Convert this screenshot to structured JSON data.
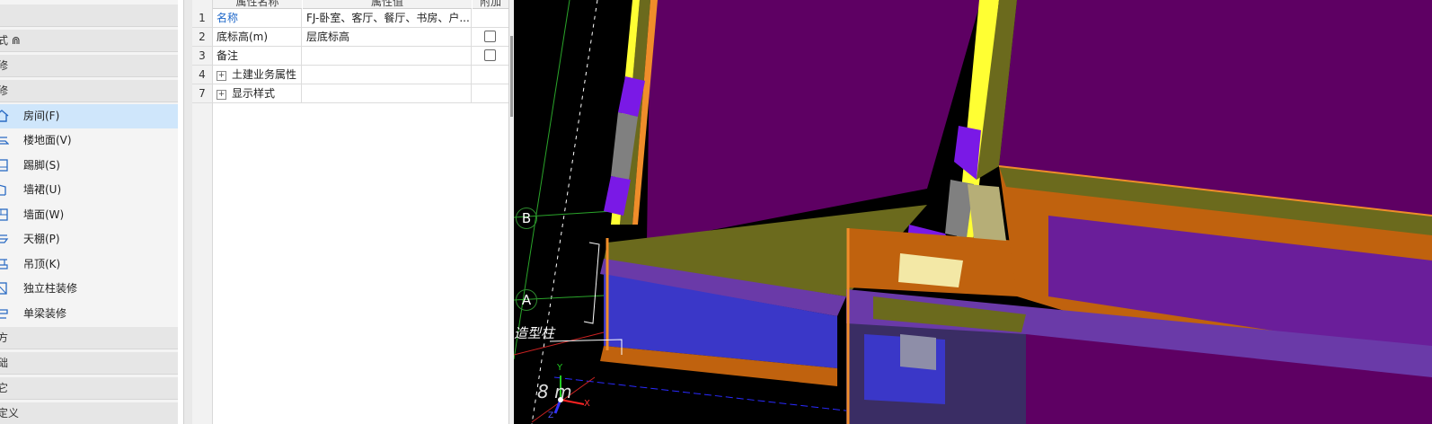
{
  "nav": {
    "groups": [
      {
        "label": ""
      },
      {
        "label": "式 ⋒"
      },
      {
        "label": "修"
      },
      {
        "label": "修"
      }
    ],
    "items": [
      {
        "label": "房间(F)",
        "icon": "room-icon",
        "selected": true
      },
      {
        "label": "楼地面(V)",
        "icon": "floor-icon"
      },
      {
        "label": "踢脚(S)",
        "icon": "skirting-icon"
      },
      {
        "label": "墙裙(U)",
        "icon": "dado-icon"
      },
      {
        "label": "墙面(W)",
        "icon": "wall-surface-icon"
      },
      {
        "label": "天棚(P)",
        "icon": "ceiling-icon"
      },
      {
        "label": "吊顶(K)",
        "icon": "suspended-ceiling-icon"
      },
      {
        "label": "独立柱装修",
        "icon": "column-finish-icon"
      },
      {
        "label": "单梁装修",
        "icon": "beam-finish-icon"
      }
    ],
    "bottom_groups": [
      {
        "label": "方"
      },
      {
        "label": "础"
      },
      {
        "label": "它"
      },
      {
        "label": "定义"
      }
    ]
  },
  "properties": {
    "columns": {
      "name": "属性名称",
      "value": "属性值",
      "extra": "附加"
    },
    "rows": [
      {
        "num": "1",
        "name": "名称",
        "value": "FJ-卧室、客厅、餐厅、书房、户...",
        "has_checkbox": false,
        "is_link": true
      },
      {
        "num": "2",
        "name": "底标高(m)",
        "value": "层底标高",
        "has_checkbox": true,
        "checked": false
      },
      {
        "num": "3",
        "name": "备注",
        "value": "",
        "has_checkbox": true,
        "checked": false
      },
      {
        "num": "4",
        "name": "土建业务属性",
        "value": "",
        "has_checkbox": false,
        "expandable": true
      },
      {
        "num": "7",
        "name": "显示样式",
        "value": "",
        "has_checkbox": false,
        "expandable": true
      }
    ]
  },
  "viewport": {
    "axis_labels": [
      "B",
      "A"
    ],
    "overlay_text": "造型柱",
    "scale_text": "8 m",
    "gizmo_axes": {
      "y": "Y",
      "x": "X",
      "z": "Z"
    },
    "colors": {
      "background": "#000000",
      "room_fill": "#5e0063",
      "wall_olive": "#6b6a1d",
      "wall_orange": "#c0620e",
      "edge_orange": "#f08d2a",
      "yellow": "#ffff33",
      "violet": "#7a19e6",
      "gray": "#808080",
      "tan": "#b6ae77",
      "window_blue": "#3a37c8"
    }
  }
}
